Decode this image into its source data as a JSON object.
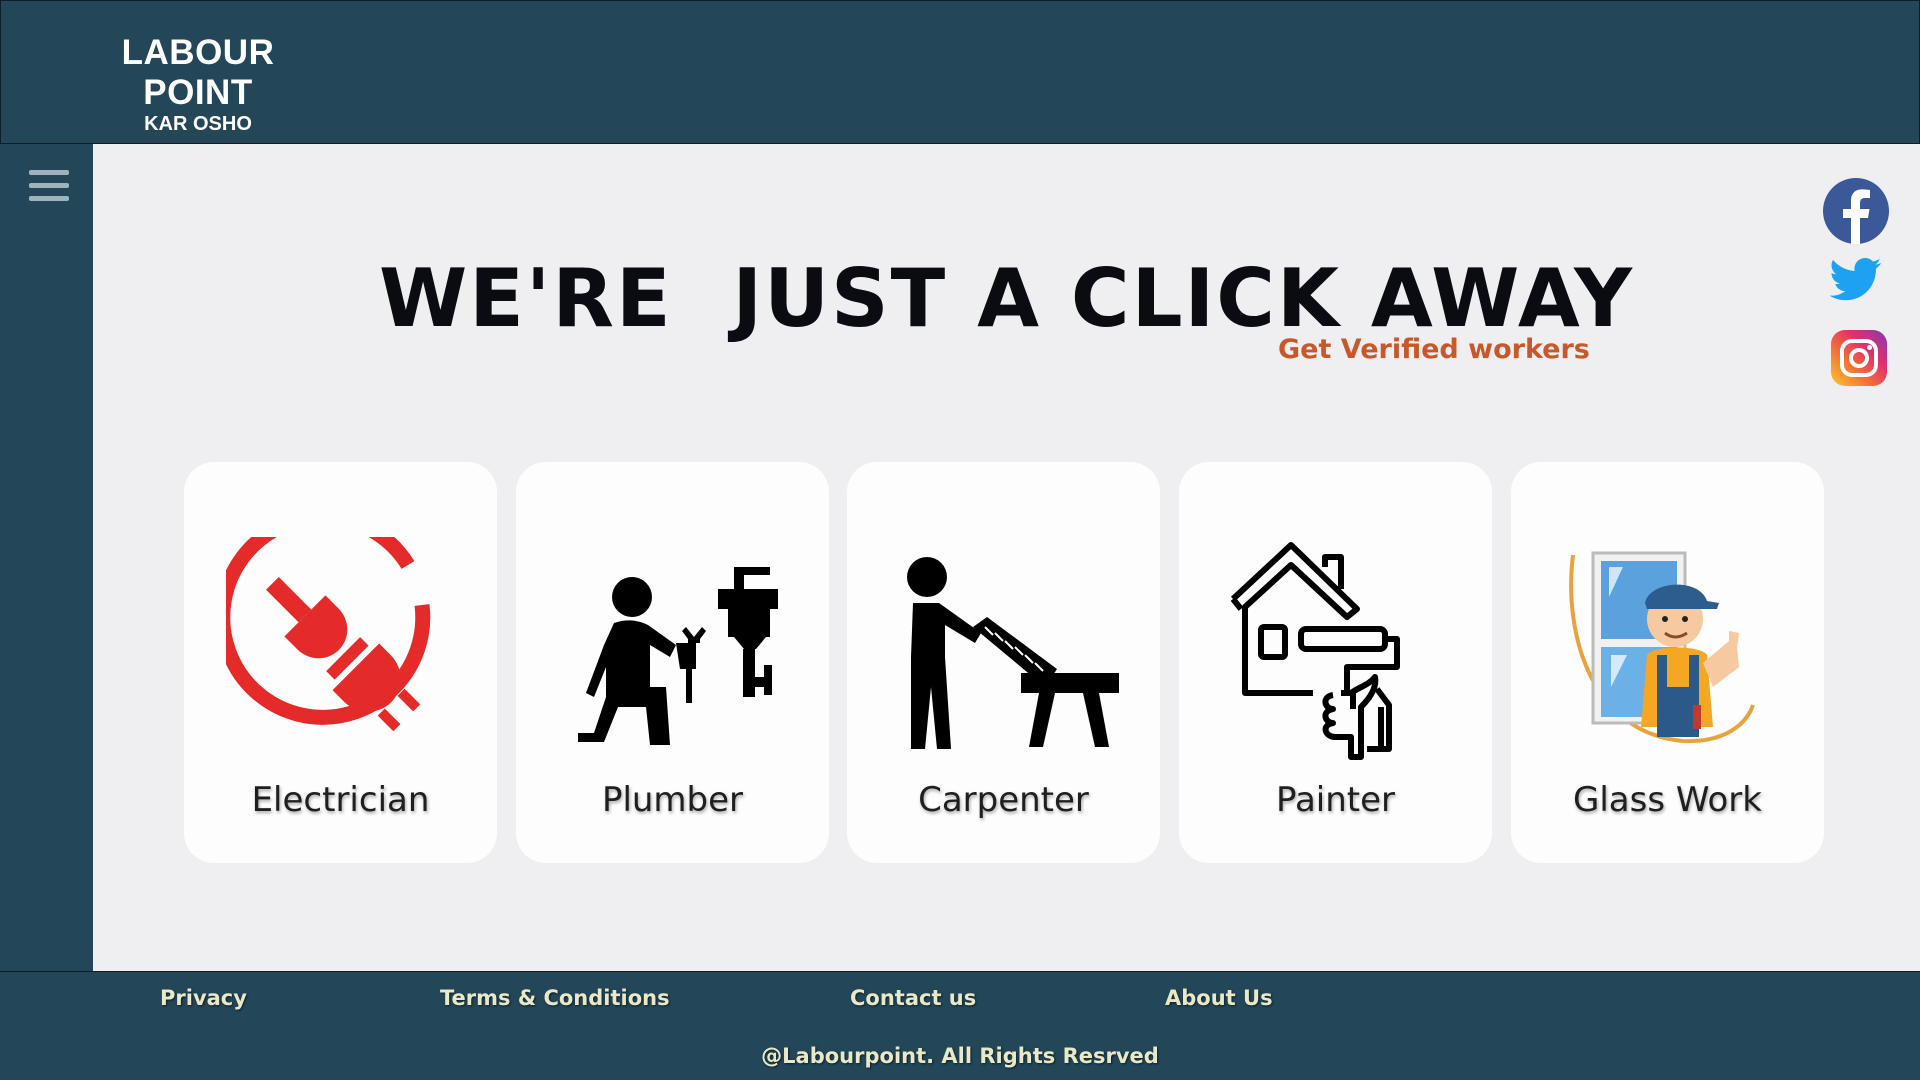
{
  "header": {
    "brand_title": "LABOUR POINT",
    "brand_subtitle": "KAR OSHO"
  },
  "sidebar": {
    "menu_icon": "hamburger-menu-icon"
  },
  "hero": {
    "title": "WE'RE  JUST A CLICK AWAY",
    "subtitle": "Get Verified workers"
  },
  "social": [
    {
      "name": "facebook",
      "icon": "facebook-icon",
      "color": "#3b5998"
    },
    {
      "name": "twitter",
      "icon": "twitter-icon",
      "color": "#1da1f2"
    },
    {
      "name": "instagram",
      "icon": "instagram-icon",
      "color": "#e1306c"
    }
  ],
  "services": [
    {
      "label": "Electrician",
      "icon": "electric-plug-icon",
      "color": "#e52a2a"
    },
    {
      "label": "Plumber",
      "icon": "plumber-icon",
      "color": "#000000"
    },
    {
      "label": "Carpenter",
      "icon": "carpenter-saw-icon",
      "color": "#000000"
    },
    {
      "label": "Painter",
      "icon": "house-paint-roller-icon",
      "color": "#000000"
    },
    {
      "label": "Glass Work",
      "icon": "glass-worker-icon",
      "color": "#2a6fb5"
    }
  ],
  "footer": {
    "links": [
      "Privacy",
      "Terms & Conditions",
      "Contact us",
      "About Us"
    ],
    "copyright": "@Labourpoint. All Rights Resrved"
  },
  "colors": {
    "primary": "#234759",
    "background": "#efeff2",
    "accent": "#c8582a"
  }
}
